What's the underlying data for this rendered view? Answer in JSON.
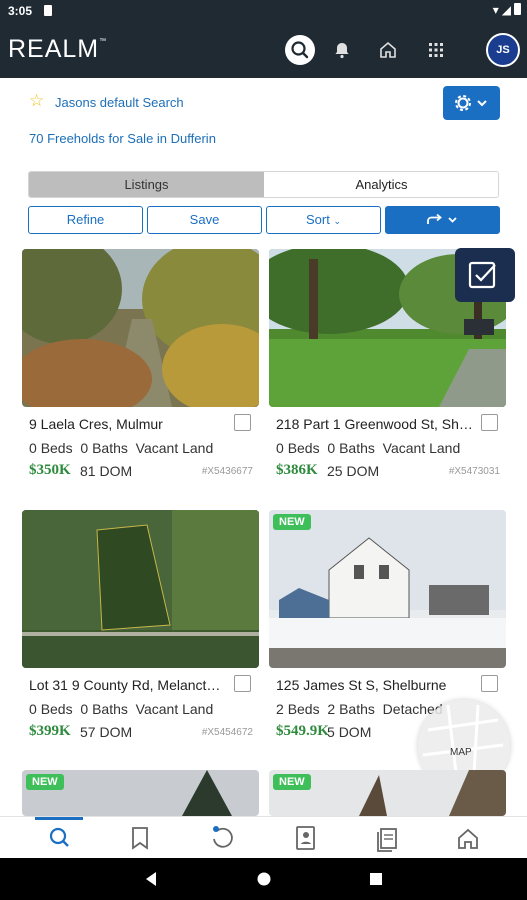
{
  "status_bar": {
    "time": "3:05"
  },
  "app_bar": {
    "logo": "REALM",
    "logo_mark": "™",
    "avatar_initials": "JS",
    "icons": [
      "search-icon",
      "bell-icon",
      "home-icon",
      "apps-grid-icon"
    ]
  },
  "saved_search": {
    "name": "Jasons default Search",
    "result_summary": "70 Freeholds for Sale in Dufferin"
  },
  "view_tabs": [
    {
      "label": "Listings",
      "active": true
    },
    {
      "label": "Analytics",
      "active": false
    }
  ],
  "actions": {
    "refine": "Refine",
    "save": "Save",
    "sort": "Sort"
  },
  "listings": [
    {
      "address": "9 Laela Cres, Mulmur",
      "beds": "0",
      "beds_label": "Beds",
      "baths": "0",
      "baths_label": "Baths",
      "type": "Vacant Land",
      "price": "$350K",
      "dom": "81",
      "dom_label": "DOM",
      "mls": "#X5436677",
      "new": false
    },
    {
      "address": "218 Part 1 Greenwood St, Sh…",
      "beds": "0",
      "beds_label": "Beds",
      "baths": "0",
      "baths_label": "Baths",
      "type": "Vacant Land",
      "price": "$386K",
      "dom": "25",
      "dom_label": "DOM",
      "mls": "#X5473031",
      "new": false
    },
    {
      "address": "Lot 31 9 County Rd, Melanct…",
      "beds": "0",
      "beds_label": "Beds",
      "baths": "0",
      "baths_label": "Baths",
      "type": "Vacant Land",
      "price": "$399K",
      "dom": "57",
      "dom_label": "DOM",
      "mls": "#X5454672",
      "new": false
    },
    {
      "address": "125 James St S, Shelburne",
      "beds": "2",
      "beds_label": "Beds",
      "baths": "2",
      "baths_label": "Baths",
      "type": "Detached",
      "price": "$549.9K",
      "dom": "5",
      "dom_label": "DOM",
      "mls": "",
      "new": true,
      "badge": "NEW"
    },
    {
      "new": true,
      "badge": "NEW"
    },
    {
      "new": true,
      "badge": "NEW"
    }
  ],
  "map_button": {
    "label": "MAP"
  },
  "bottom_nav": [
    "search-icon",
    "bookmark-icon",
    "refresh-icon",
    "contacts-icon",
    "documents-icon",
    "home-icon"
  ],
  "colors": {
    "accent": "#1b6fc3",
    "price": "#2e8b3d",
    "header": "#1f2a33",
    "new_badge": "#3fbf5a"
  }
}
